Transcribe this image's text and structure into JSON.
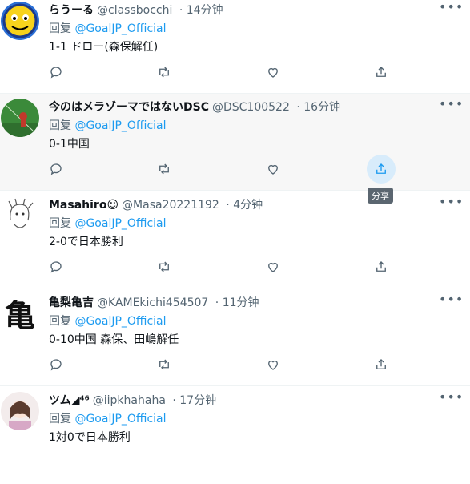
{
  "reply_prefix": "回复",
  "share_tooltip": "分享",
  "colors": {
    "accent": "#1d9bf0",
    "muted": "#536471",
    "hover_bg": "#f7f7f7"
  },
  "tweets": [
    {
      "name": "らうーる",
      "handle": "@classbocchi",
      "time": "14分钟",
      "mention": "@GoalJP_Official",
      "text": "1-1 ドロー(森保解任)"
    },
    {
      "name": "今のはメラゾーマではないDSC",
      "handle": "@DSC100522",
      "time": "16分钟",
      "mention": "@GoalJP_Official",
      "text": "0-1中国"
    },
    {
      "name": "Masahiro☺",
      "handle": "@Masa20221192",
      "time": "4分钟",
      "mention": "@GoalJP_Official",
      "text": "2-0で日本勝利"
    },
    {
      "name": "亀梨亀吉",
      "handle": "@KAMEkichi454507",
      "time": "11分钟",
      "mention": "@GoalJP_Official",
      "text": "0-10中国 森保、田嶋解任"
    },
    {
      "name": "ツム◢⁴⁶",
      "handle": "@iipkhahaha",
      "time": "17分钟",
      "mention": "@GoalJP_Official",
      "text": "1対0で日本勝利"
    }
  ]
}
